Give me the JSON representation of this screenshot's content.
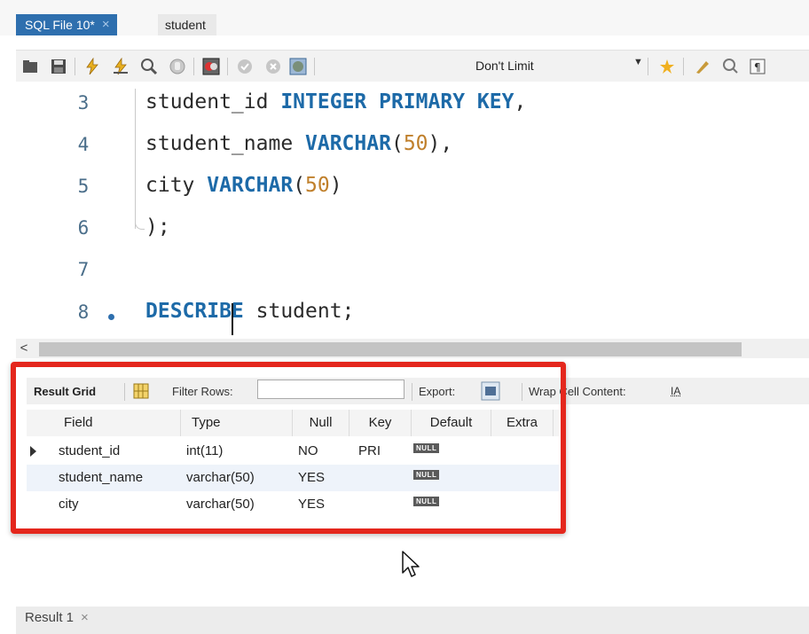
{
  "tabs": [
    {
      "label": "SQL File 10*",
      "close": "×",
      "active": true
    },
    {
      "label": "student",
      "active": false
    }
  ],
  "toolbar": {
    "icons": [
      "open-folder-icon",
      "save-icon",
      "execute-icon",
      "execute-selection-icon",
      "explain-icon",
      "stop-icon",
      "toggle-error-icon",
      "commit-icon",
      "rollback-icon",
      "autocommit-icon",
      "beautify-icon",
      "find-icon",
      "invisible-chars-icon"
    ],
    "limit": "Don't Limit"
  },
  "editor": {
    "line_numbers": [
      "3",
      "4",
      "5",
      "6",
      "7",
      "8"
    ],
    "lines": [
      {
        "plain": "student_id ",
        "kw": "INTEGER PRIMARY KEY",
        "tail": ","
      },
      {
        "plain": "student_name ",
        "kw": "VARCHAR",
        "open": "(",
        "num": "50",
        "close": "),"
      },
      {
        "plain": "city ",
        "kw": "VARCHAR",
        "open": "(",
        "num": "50",
        "close": ")"
      },
      {
        "plain": ");"
      },
      {
        "plain": ""
      },
      {
        "kw": "DESCRIBE",
        "plain": " student;"
      }
    ]
  },
  "scrollbar": {
    "left_arrow": "<"
  },
  "result_toolbar": {
    "result_grid": "Result Grid",
    "filter_rows": "Filter Rows:",
    "filter_value": "",
    "export": "Export:",
    "wrap": "Wrap Cell Content:",
    "wrap_icon": "IA"
  },
  "grid": {
    "headers": [
      "Field",
      "Type",
      "Null",
      "Key",
      "Default",
      "Extra"
    ],
    "rows": [
      {
        "field": "student_id",
        "type": "int(11)",
        "null": "NO",
        "key": "PRI",
        "default": "NULL",
        "extra": ""
      },
      {
        "field": "student_name",
        "type": "varchar(50)",
        "null": "YES",
        "key": "",
        "default": "NULL",
        "extra": ""
      },
      {
        "field": "city",
        "type": "varchar(50)",
        "null": "YES",
        "key": "",
        "default": "NULL",
        "extra": ""
      }
    ]
  },
  "bottom_tab": {
    "label": "Result 1",
    "close": "×"
  },
  "colors": {
    "accent": "#2e6fae",
    "highlight": "#e4271d",
    "keyword": "#1d6aa8",
    "number": "#c0802c"
  }
}
